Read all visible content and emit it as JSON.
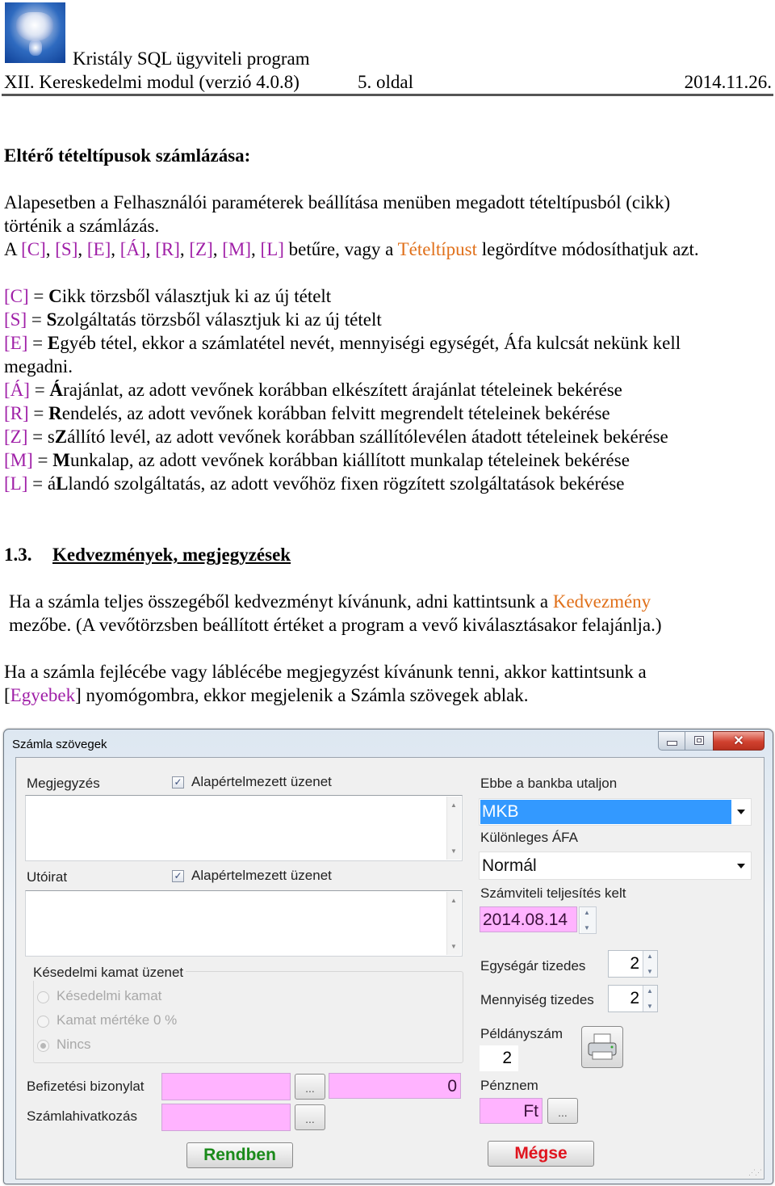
{
  "header": {
    "logo_icon": "crystal-logo-icon",
    "program_name": "Kristály SQL ügyviteli program",
    "module": "XII. Kereskedelmi modul (verzió 4.0.8)",
    "page": "5. oldal",
    "date": "2014.11.26."
  },
  "section1": {
    "heading": "Eltérő tételtípusok számlázása:",
    "para1_line1": "Alapesetben a Felhasználói paraméterek beállítása menüben megadott tételtípusból (cikk)",
    "para1_line2": "történik a számlázás.",
    "para2": {
      "prefix": "A ",
      "keys": [
        "[C]",
        "[S]",
        "[E]",
        "[Á]",
        "[R]",
        "[Z]",
        "[M]",
        "[L]"
      ],
      "middle": " betűre, vagy a ",
      "link": "Tételtípust",
      "suffix": " legördítve módosíthatjuk azt."
    },
    "definitions": [
      {
        "key": "[C]",
        "eq": " = ",
        "bold": "C",
        "rest": "ikk törzsből választjuk ki az új tételt"
      },
      {
        "key": "[S]",
        "eq": " = ",
        "bold": "S",
        "rest": "zolgáltatás törzsből választjuk ki az új tételt"
      },
      {
        "key": "[E]",
        "eq": " = ",
        "bold": "E",
        "rest": "gyéb tétel, ekkor a számlatétel nevét, mennyiségi egységét, Áfa kulcsát nekünk kell"
      },
      {
        "key": "[Á]",
        "eq": " = ",
        "bold": "Á",
        "rest": "rajánlat, az adott vevőnek korábban elkészített árajánlat tételeinek bekérése"
      },
      {
        "key": "[R]",
        "eq": " = ",
        "bold": "R",
        "rest": "endelés, az adott vevőnek korábban felvitt megrendelt tételeinek bekérése"
      },
      {
        "key": "[Z]",
        "eq": " = s",
        "bold": "Z",
        "rest": "állító levél, az adott vevőnek korábban szállítólevélen átadott tételeinek bekérése"
      },
      {
        "key": "[M]",
        "eq": " = ",
        "bold": "M",
        "rest": "unkalap, az adott vevőnek korábban kiállított munkalap tételeinek bekérése"
      },
      {
        "key": "[L]",
        "eq": " = á",
        "bold": "L",
        "rest": "landó szolgáltatás, az adott vevőhöz fixen rögzített szolgáltatások bekérése"
      }
    ],
    "e_continuation": "megadni."
  },
  "section2": {
    "number": "1.3.",
    "title": "Kedvezmények, megjegyzések",
    "para1_line1_prefix": "Ha a számla teljes összegéből kedvezményt kívánunk, adni kattintsunk a ",
    "para1_link": "Kedvezmény",
    "para1_line2": "mezőbe. (A vevőtörzsben beállított értéket a program a vevő kiválasztásakor felajánlja.)",
    "para2_line1": "Ha a számla fejlécébe vagy láblécébe megjegyzést kívánunk tenni, akkor kattintsunk a",
    "para2_bracket_open": "[",
    "para2_link": "Egyebek",
    "para2_rest": "] nyomógombra, ekkor megjelenik a Számla szövegek ablak."
  },
  "dialog": {
    "title": "Számla szövegek",
    "megjegyzes_label": "Megjegyzés",
    "megjegyzes_default_checkbox": {
      "label": "Alapértelmezett üzenet",
      "checked": true
    },
    "megjegyzes_text": "",
    "utoirat_label": "Utóirat",
    "utoirat_default_checkbox": {
      "label": "Alapértelmezett üzenet",
      "checked": true
    },
    "utoirat_text": "",
    "late_interest_group": {
      "title": "Késedelmi kamat üzenet",
      "options": [
        {
          "label": "Késedelmi kamat",
          "selected": false
        },
        {
          "label": "Kamat mértéke 0 %",
          "selected": false
        },
        {
          "label": "Nincs",
          "selected": true
        }
      ]
    },
    "befizetesi_label": "Befizetési bizonylat",
    "befizetesi_value": "",
    "befizetesi_amount": "0",
    "szamlahivatkozas_label": "Számlahivatkozás",
    "szamlahivatkozas_value": "",
    "browse_label": "...",
    "ok_label": "Rendben",
    "bank_label": "Ebbe a bankba utaljon",
    "bank_value": "MKB",
    "afa_label": "Különleges ÁFA",
    "afa_value": "Normál",
    "teljesites_label": "Számviteli teljesítés kelt",
    "teljesites_value": "2014.08.14",
    "egysegar_label": "Egységár tizedes",
    "egysegar_value": "2",
    "mennyiseg_label": "Mennyiség tizedes",
    "mennyiseg_value": "2",
    "peldanyszam_label": "Példányszám",
    "peldanyszam_value": "2",
    "penznem_label": "Pénznem",
    "penznem_value": "Ft",
    "cancel_label": "Mégse",
    "colors": {
      "ok": "#1a8a1a",
      "cancel": "#e0141e",
      "required_field": "#ffb3ff",
      "selection": "#3399ff"
    }
  }
}
